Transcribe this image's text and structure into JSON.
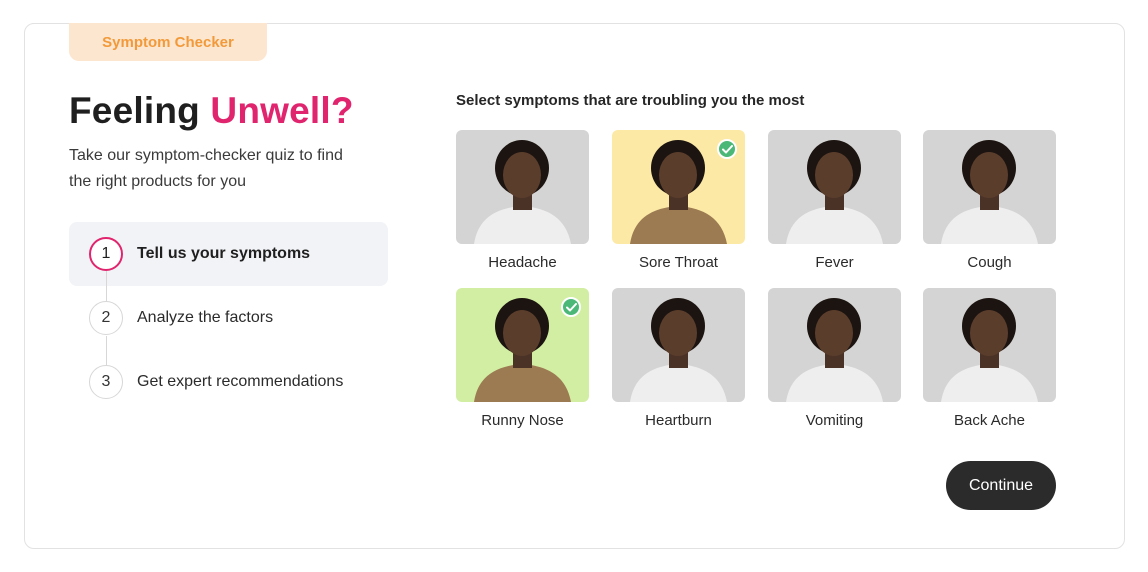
{
  "tag": "Symptom Checker",
  "heading": {
    "part1": "Feeling ",
    "part2": "Unwell?"
  },
  "subtitle": "Take our symptom-checker quiz to find the right products for you",
  "steps": [
    {
      "number": "1",
      "label": "Tell us your symptoms",
      "active": true
    },
    {
      "number": "2",
      "label": "Analyze the factors",
      "active": false
    },
    {
      "number": "3",
      "label": "Get expert recommendations",
      "active": false
    }
  ],
  "question": "Select symptoms that are troubling you the most",
  "symptoms": [
    {
      "label": "Headache",
      "selected": false,
      "bg": "#d4d4d4"
    },
    {
      "label": "Sore Throat",
      "selected": true,
      "bg": "#fbe9a5"
    },
    {
      "label": "Fever",
      "selected": false,
      "bg": "#d4d4d4"
    },
    {
      "label": "Cough",
      "selected": false,
      "bg": "#d4d4d4"
    },
    {
      "label": "Runny Nose",
      "selected": true,
      "bg": "#d2eea3"
    },
    {
      "label": "Heartburn",
      "selected": false,
      "bg": "#d4d4d4"
    },
    {
      "label": "Vomiting",
      "selected": false,
      "bg": "#d4d4d4"
    },
    {
      "label": "Back Ache",
      "selected": false,
      "bg": "#d4d4d4"
    }
  ],
  "continue_label": "Continue",
  "colors": {
    "accent": "#e0256e",
    "tag_bg": "#fde6cf",
    "tag_text": "#f29a3a",
    "check": "#4cb877",
    "button": "#2b2b2b"
  }
}
